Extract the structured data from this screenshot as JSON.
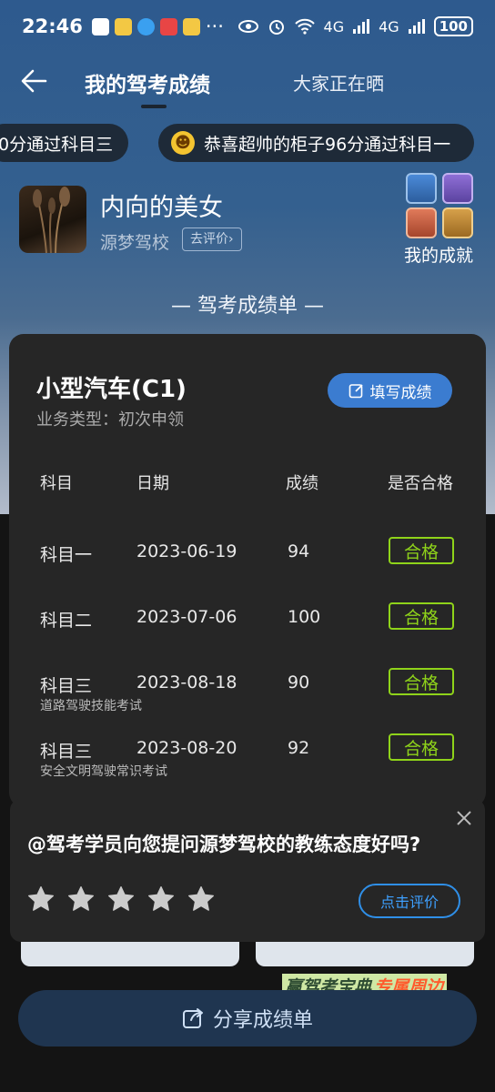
{
  "status_bar": {
    "time": "22:46",
    "more": "···",
    "network1": "4G",
    "network2": "4G",
    "battery": "100"
  },
  "nav": {
    "title": "我的驾考成绩",
    "tab2": "大家正在晒"
  },
  "ticker": [
    "0分通过科目三",
    "恭喜超帅的柜子96分通过科目一"
  ],
  "profile": {
    "name": "内向的美女",
    "school": "源梦驾校",
    "rate_button": "去评价",
    "achievements_label": "我的成就"
  },
  "section_heading": "— 驾考成绩单 —",
  "card": {
    "vehicle": "小型汽车(C1)",
    "business_type": "业务类型：初次申领",
    "fill_button": "填写成绩",
    "headers": [
      "科目",
      "日期",
      "成绩",
      "是否合格"
    ],
    "rows": [
      {
        "subject": "科目一",
        "date": "2023-06-19",
        "score": "94",
        "result": "合格",
        "note": ""
      },
      {
        "subject": "科目二",
        "date": "2023-07-06",
        "score": "100",
        "result": "合格",
        "note": ""
      },
      {
        "subject": "科目三",
        "date": "2023-08-18",
        "score": "90",
        "result": "合格",
        "note": "道路驾驶技能考试"
      },
      {
        "subject": "科目三",
        "date": "2023-08-20",
        "score": "92",
        "result": "合格",
        "note": "安全文明驾驶常识考试"
      }
    ]
  },
  "popup": {
    "question": "@驾考学员向您提问源梦驾校的教练态度好吗?",
    "stars": 5,
    "rate_button": "点击评价"
  },
  "promo": {
    "part1": "赢驾考宝典",
    "part2": "专属周边"
  },
  "share_button": "分享成绩单",
  "colors": {
    "header_blue": "#2e5a8e",
    "accent_blue": "#3b7cd0",
    "pass_green": "#8fd31a",
    "card_bg": "#262626"
  }
}
